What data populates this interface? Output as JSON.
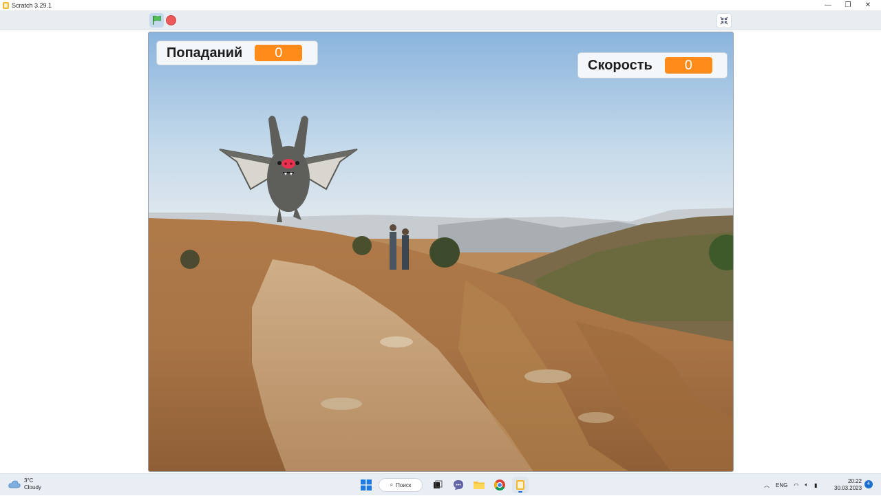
{
  "window": {
    "title": "Scratch 3.29.1",
    "minimize_glyph": "—",
    "maximize_glyph": "❐",
    "close_glyph": "✕"
  },
  "toolbar": {
    "green_flag_icon": "green-flag-icon",
    "stop_icon": "stop-icon",
    "shrink_icon": "shrink-stage-icon"
  },
  "stage": {
    "monitors": [
      {
        "label": "Попаданий",
        "value": "0"
      },
      {
        "label": "Скорость",
        "value": "0"
      }
    ],
    "sprite": "bat",
    "backdrop": "desert-canyon"
  },
  "taskbar": {
    "weather_temp": "3°C",
    "weather_desc": "Cloudy",
    "search_label": "Поиск",
    "language": "ENG",
    "time": "20:22",
    "date": "30.03.2023",
    "notification_count": "4"
  },
  "colors": {
    "monitor_value_bg": "#ff8c1a",
    "stop_red": "#ec5959",
    "flag_green": "#4cbf56"
  }
}
